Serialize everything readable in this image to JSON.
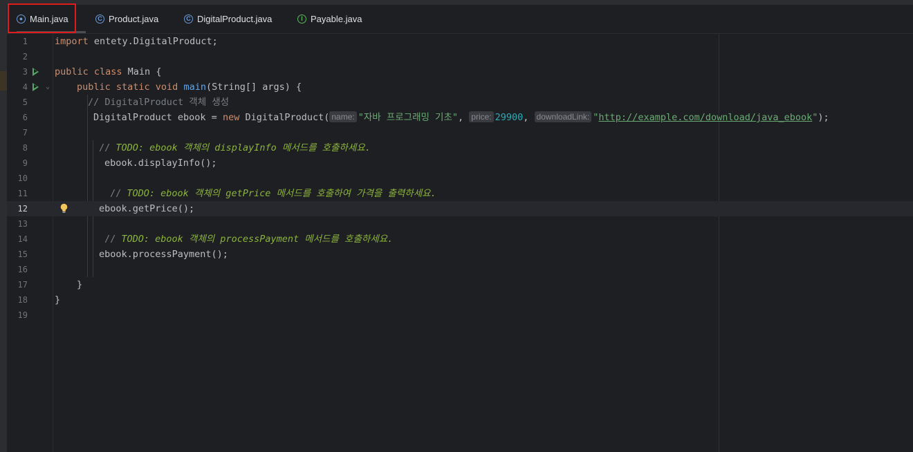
{
  "tabs": [
    {
      "label": "Main.java",
      "icon": "java-main-class-icon",
      "active": true
    },
    {
      "label": "Product.java",
      "icon": "java-class-icon",
      "active": false
    },
    {
      "label": "DigitalProduct.java",
      "icon": "java-class-icon",
      "active": false
    },
    {
      "label": "Payable.java",
      "icon": "java-interface-icon",
      "active": false
    }
  ],
  "editor": {
    "current_line": 12,
    "line_numbers": [
      "1",
      "2",
      "3",
      "4",
      "5",
      "6",
      "7",
      "8",
      "9",
      "10",
      "11",
      "12",
      "13",
      "14",
      "15",
      "16",
      "17",
      "18",
      "19"
    ],
    "code": {
      "l1": {
        "kw": "import",
        "rest": " entety.DigitalProduct;"
      },
      "l3": {
        "kw": "public class",
        "rest": " Main {"
      },
      "l4": {
        "kw": "public static void",
        "fn": "main",
        "rest": "(String[] args) {"
      },
      "l5": {
        "comment": "// DigitalProduct 객체 생성"
      },
      "l6": {
        "pre": "DigitalProduct ebook = ",
        "kw": "new",
        "ctor": " DigitalProduct(",
        "hint_name": "name:",
        "arg_name": "\"자바 프로그래밍 기초\"",
        "sep1": ", ",
        "hint_price": "price:",
        "arg_price": "29900",
        "sep2": ", ",
        "hint_link": "downloadLink:",
        "q_open": "\"",
        "arg_link": "http://example.com/download/java_ebook",
        "q_close": "\"",
        "end": ");"
      },
      "l8": {
        "slash": "// ",
        "todo": "TODO: ebook 객체의 displayInfo 메서드를 호출하세요."
      },
      "l9": {
        "text": "ebook.displayInfo();"
      },
      "l11": {
        "slash": "// ",
        "todo": "TODO: ebook 객체의 getPrice 메서드를 호출하여 가격을 출력하세요."
      },
      "l12": {
        "text": "ebook.getPrice();"
      },
      "l14": {
        "slash": "// ",
        "todo": "TODO: ebook 객체의 processPayment 메서드를 호출하세요."
      },
      "l15": {
        "text": "ebook.processPayment();"
      },
      "l17": {
        "text": "}"
      },
      "l18": {
        "text": "}"
      }
    }
  },
  "colors": {
    "keyword": "#cf8e6d",
    "method": "#56a8f5",
    "string": "#6aab73",
    "number": "#2aacb8",
    "comment": "#7a7e85",
    "todo": "#8bb33d",
    "highlight_box": "#e01b1b"
  }
}
